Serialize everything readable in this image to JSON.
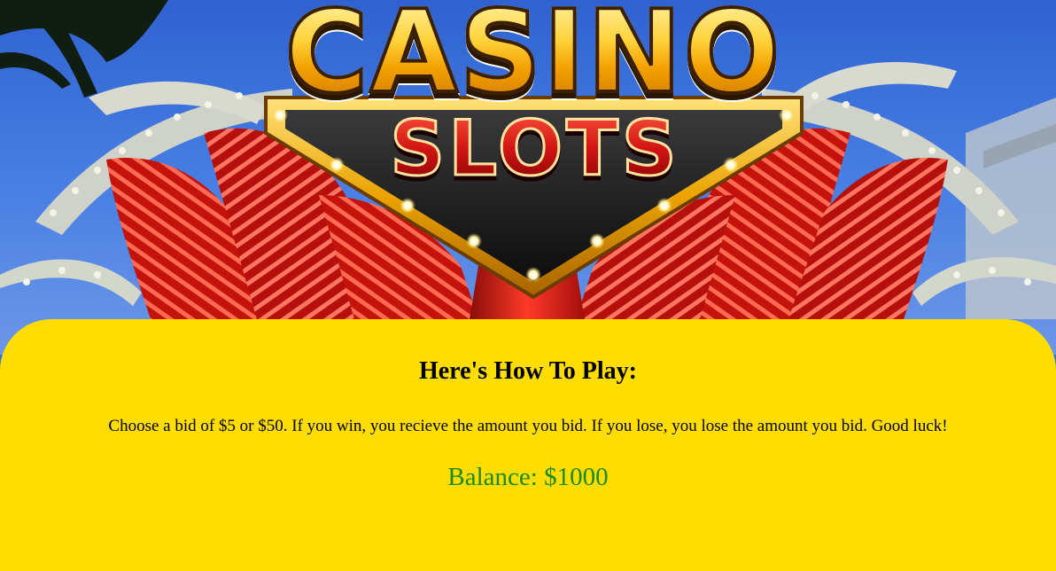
{
  "logo": {
    "top_word": "CASINO",
    "bottom_word": "SLOTS"
  },
  "instructions": {
    "heading": "Here's How To Play:",
    "text": "Choose a bid of $5 or $50. If you win, you recieve the amount you bid. If you lose, you lose the amount you bid. Good luck!"
  },
  "balance": {
    "label": "Balance: $1000"
  },
  "colors": {
    "panel_background": "#ffdd00",
    "balance_text": "#1a8a1a",
    "sky": "#3a6fd6",
    "neon": "#e8241c",
    "logo_gold": "#ffcf2e"
  }
}
